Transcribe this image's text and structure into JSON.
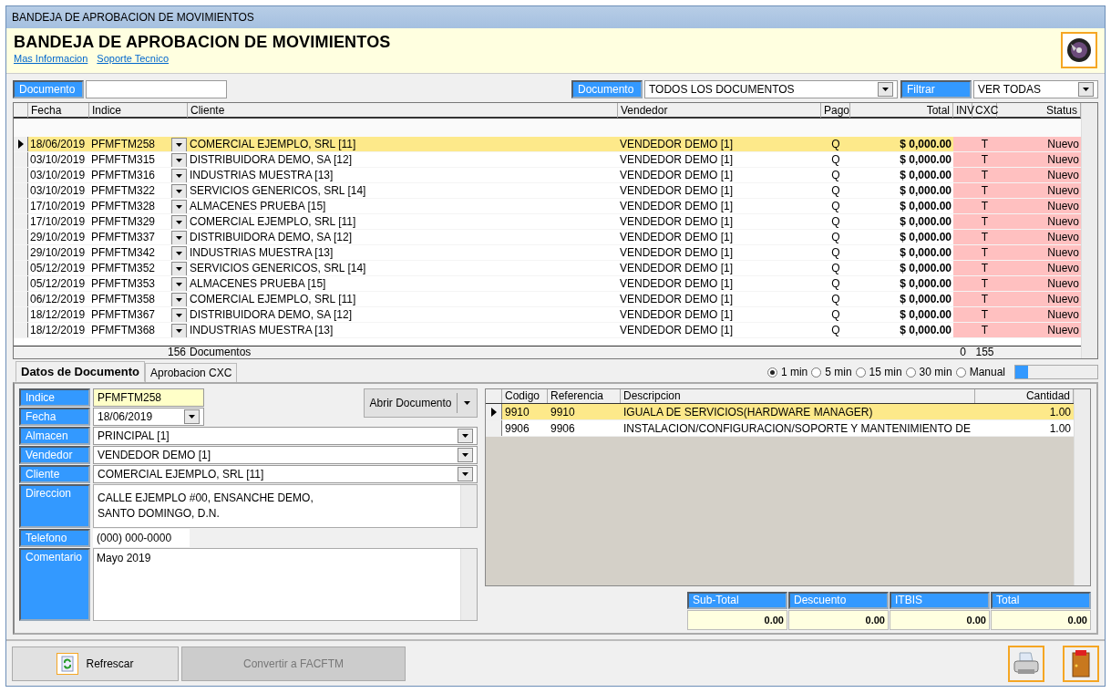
{
  "window": {
    "title": "BANDEJA DE APROBACION DE MOVIMIENTOS"
  },
  "header": {
    "title": "BANDEJA DE APROBACION DE MOVIMIENTOS",
    "links": [
      "Mas Informacion",
      "Soporte Tecnico"
    ]
  },
  "filters": {
    "search": {
      "label": "Documento"
    },
    "document_type": {
      "label": "Documento",
      "value": "TODOS LOS DOCUMENTOS"
    },
    "filter": {
      "label": "Filtrar",
      "value": "VER TODAS"
    }
  },
  "grid": {
    "columns": [
      "Fecha",
      "Indice",
      "Cliente",
      "Vendedor",
      "Pago",
      "Total",
      "INV",
      "CXC",
      "Status"
    ],
    "rows": [
      {
        "fecha": "18/06/2019",
        "indice": "PFMFTM258",
        "cliente": "COMERCIAL EJEMPLO, SRL [11]",
        "vendedor": "VENDEDOR DEMO [1]",
        "pago": "Q",
        "total": "$ 0,000.00",
        "cxc": "T",
        "status": "Nuevo",
        "selected": true
      },
      {
        "fecha": "03/10/2019",
        "indice": "PFMFTM315",
        "cliente": "DISTRIBUIDORA DEMO, SA [12]",
        "vendedor": "VENDEDOR DEMO [1]",
        "pago": "Q",
        "total": "$ 0,000.00",
        "cxc": "T",
        "status": "Nuevo",
        "selected": false
      },
      {
        "fecha": "03/10/2019",
        "indice": "PFMFTM316",
        "cliente": "INDUSTRIAS MUESTRA [13]",
        "vendedor": "VENDEDOR DEMO [1]",
        "pago": "Q",
        "total": "$ 0,000.00",
        "cxc": "T",
        "status": "Nuevo",
        "selected": false
      },
      {
        "fecha": "03/10/2019",
        "indice": "PFMFTM322",
        "cliente": "SERVICIOS GENERICOS, SRL [14]",
        "vendedor": "VENDEDOR DEMO [1]",
        "pago": "Q",
        "total": "$ 0,000.00",
        "cxc": "T",
        "status": "Nuevo",
        "selected": false
      },
      {
        "fecha": "17/10/2019",
        "indice": "PFMFTM328",
        "cliente": "ALMACENES PRUEBA [15]",
        "vendedor": "VENDEDOR DEMO [1]",
        "pago": "Q",
        "total": "$ 0,000.00",
        "cxc": "T",
        "status": "Nuevo",
        "selected": false
      },
      {
        "fecha": "17/10/2019",
        "indice": "PFMFTM329",
        "cliente": "COMERCIAL EJEMPLO, SRL [11]",
        "vendedor": "VENDEDOR DEMO [1]",
        "pago": "Q",
        "total": "$ 0,000.00",
        "cxc": "T",
        "status": "Nuevo",
        "selected": false
      },
      {
        "fecha": "29/10/2019",
        "indice": "PFMFTM337",
        "cliente": "DISTRIBUIDORA DEMO, SA [12]",
        "vendedor": "VENDEDOR DEMO [1]",
        "pago": "Q",
        "total": "$ 0,000.00",
        "cxc": "T",
        "status": "Nuevo",
        "selected": false
      },
      {
        "fecha": "29/10/2019",
        "indice": "PFMFTM342",
        "cliente": "INDUSTRIAS MUESTRA [13]",
        "vendedor": "VENDEDOR DEMO [1]",
        "pago": "Q",
        "total": "$ 0,000.00",
        "cxc": "T",
        "status": "Nuevo",
        "selected": false
      },
      {
        "fecha": "05/12/2019",
        "indice": "PFMFTM352",
        "cliente": "SERVICIOS GENERICOS, SRL [14]",
        "vendedor": "VENDEDOR DEMO [1]",
        "pago": "Q",
        "total": "$ 0,000.00",
        "cxc": "T",
        "status": "Nuevo",
        "selected": false
      },
      {
        "fecha": "05/12/2019",
        "indice": "PFMFTM353",
        "cliente": "ALMACENES PRUEBA [15]",
        "vendedor": "VENDEDOR DEMO [1]",
        "pago": "Q",
        "total": "$ 0,000.00",
        "cxc": "T",
        "status": "Nuevo",
        "selected": false
      },
      {
        "fecha": "06/12/2019",
        "indice": "PFMFTM358",
        "cliente": "COMERCIAL EJEMPLO, SRL [11]",
        "vendedor": "VENDEDOR DEMO [1]",
        "pago": "Q",
        "total": "$ 0,000.00",
        "cxc": "T",
        "status": "Nuevo",
        "selected": false
      },
      {
        "fecha": "18/12/2019",
        "indice": "PFMFTM367",
        "cliente": "DISTRIBUIDORA DEMO, SA [12]",
        "vendedor": "VENDEDOR DEMO [1]",
        "pago": "Q",
        "total": "$ 0,000.00",
        "cxc": "T",
        "status": "Nuevo",
        "selected": false
      },
      {
        "fecha": "18/12/2019",
        "indice": "PFMFTM368",
        "cliente": "INDUSTRIAS MUESTRA [13]",
        "vendedor": "VENDEDOR DEMO [1]",
        "pago": "Q",
        "total": "$ 0,000.00",
        "cxc": "T",
        "status": "Nuevo",
        "selected": false
      }
    ],
    "footer": {
      "count": "156",
      "count_label": "Documentos",
      "inv_total": "0",
      "cxc_total": "155"
    }
  },
  "refresh": {
    "options": [
      {
        "label": "1 min",
        "selected": true
      },
      {
        "label": "5 min",
        "selected": false
      },
      {
        "label": "15 min",
        "selected": false
      },
      {
        "label": "30 min",
        "selected": false
      },
      {
        "label": "Manual",
        "selected": false
      }
    ],
    "level": 0.15
  },
  "tabs": [
    {
      "label": "Datos de Documento",
      "selected": true
    },
    {
      "label": "Aprobacion CXC",
      "selected": false
    }
  ],
  "form": {
    "fields": [
      {
        "label": "Indice",
        "kind": "readonly",
        "value": "PFMFTM258"
      },
      {
        "label": "Fecha",
        "kind": "date",
        "value": "18/06/2019"
      },
      {
        "label": "Almacen",
        "kind": "combo",
        "value": "PRINCIPAL [1]"
      },
      {
        "label": "Vendedor",
        "kind": "combo",
        "value": "VENDEDOR DEMO [1]"
      },
      {
        "label": "Cliente",
        "kind": "combo",
        "value": "COMERCIAL EJEMPLO, SRL [11]"
      },
      {
        "label": "Direccion",
        "kind": "address",
        "lines": [
          "CALLE EJEMPLO #00, ENSANCHE DEMO,",
          "SANTO DOMINGO, D.N."
        ]
      },
      {
        "label": "Telefono",
        "kind": "short",
        "value": "(000) 000-0000"
      },
      {
        "label": "Comentario",
        "kind": "memo",
        "value": "Mayo 2019"
      }
    ],
    "open_button": "Abrir Documento"
  },
  "items": {
    "columns": [
      "Codigo",
      "Referencia",
      "Descripcion",
      "Cantidad"
    ],
    "rows": [
      {
        "codigo": "9910",
        "referencia": "9910",
        "descripcion": "IGUALA DE SERVICIOS(HARDWARE MANAGER)",
        "cantidad": "1.00",
        "selected": true
      },
      {
        "codigo": "9906",
        "referencia": "9906",
        "descripcion": "INSTALACION/CONFIGURACION/SOPORTE Y MANTENIMIENTO DE",
        "cantidad": "1.00",
        "selected": false
      }
    ]
  },
  "totals": [
    {
      "label": "Sub-Total",
      "value": "0.00"
    },
    {
      "label": "Descuento",
      "value": "0.00"
    },
    {
      "label": "ITBIS",
      "value": "0.00"
    },
    {
      "label": "Total",
      "value": "0.00"
    }
  ],
  "buttons": {
    "refresh": {
      "label": "Refrescar",
      "disabled": false
    },
    "convert": {
      "label": "Convertir a FACFTM",
      "disabled": true
    }
  }
}
